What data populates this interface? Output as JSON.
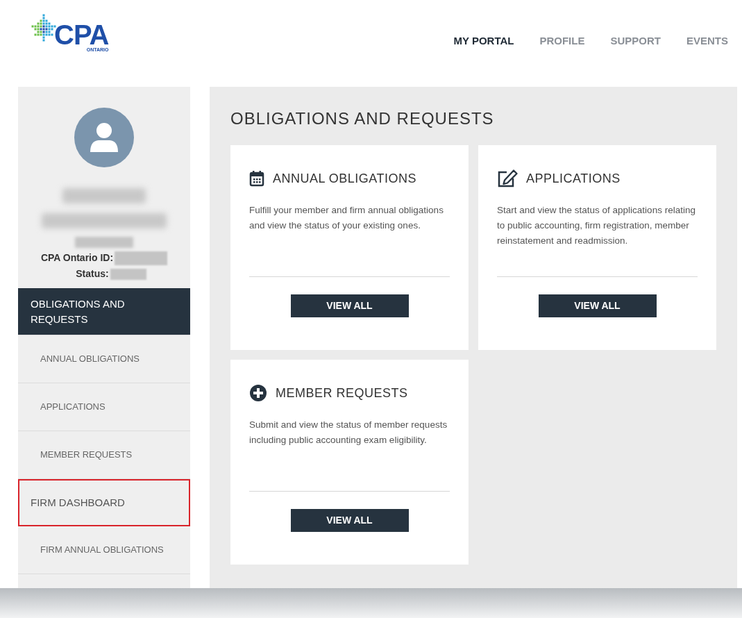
{
  "logo": {
    "wordmark": "CPA",
    "region": "ONTARIO"
  },
  "nav": [
    {
      "label": "MY PORTAL",
      "selected": true
    },
    {
      "label": "PROFILE",
      "selected": false
    },
    {
      "label": "SUPPORT",
      "selected": false
    },
    {
      "label": "EVENTS",
      "selected": false
    }
  ],
  "profile": {
    "id_label": "CPA Ontario ID:",
    "status_label": "Status:"
  },
  "sidebar": {
    "items": [
      {
        "label": "OBLIGATIONS AND REQUESTS",
        "kind": "section",
        "selected": true,
        "highlighted": false
      },
      {
        "label": "ANNUAL OBLIGATIONS",
        "kind": "item",
        "selected": false,
        "highlighted": false
      },
      {
        "label": "APPLICATIONS",
        "kind": "item",
        "selected": false,
        "highlighted": false
      },
      {
        "label": "MEMBER REQUESTS",
        "kind": "item",
        "selected": false,
        "highlighted": false
      },
      {
        "label": "FIRM DASHBOARD",
        "kind": "section",
        "selected": false,
        "highlighted": true
      },
      {
        "label": "FIRM ANNUAL OBLIGATIONS",
        "kind": "item",
        "selected": false,
        "highlighted": false
      }
    ]
  },
  "main": {
    "title": "OBLIGATIONS AND REQUESTS",
    "cards": [
      {
        "kind": "calendar",
        "title": "ANNUAL OBLIGATIONS",
        "text": "Fulfill your member and firm annual obligations and view the status of your existing ones.",
        "button": "VIEW ALL"
      },
      {
        "kind": "edit",
        "title": "APPLICATIONS",
        "text": "Start and view the status of applications relating to public accounting, firm registration, member reinstatement and readmission.",
        "button": "VIEW ALL"
      },
      {
        "kind": "plus",
        "title": "MEMBER REQUESTS",
        "text": "Submit and view the status of member requests including public accounting exam eligibility.",
        "button": "VIEW ALL"
      }
    ]
  }
}
